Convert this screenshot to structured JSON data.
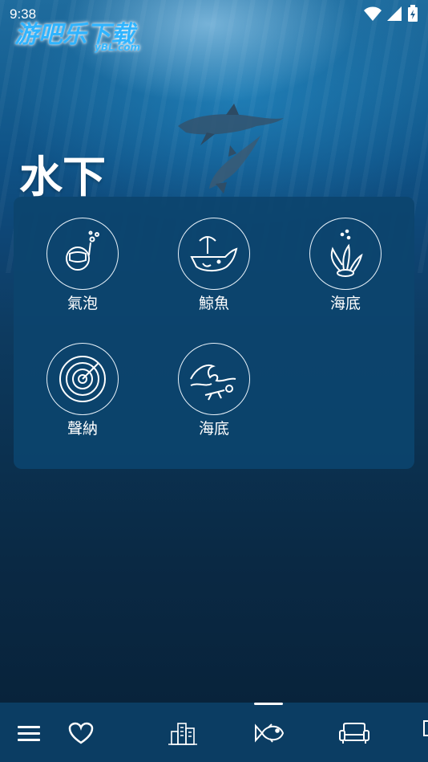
{
  "status_bar": {
    "time": "9:38",
    "icons": [
      "wifi-icon",
      "signal-icon",
      "battery-charging-icon"
    ]
  },
  "watermark": {
    "text": "游吧乐下载",
    "sub": "yBL.com"
  },
  "page": {
    "title": "水下"
  },
  "sounds": [
    {
      "label": "氣泡",
      "icon": "diver-bubbles-icon"
    },
    {
      "label": "鯨魚",
      "icon": "whale-icon"
    },
    {
      "label": "海底",
      "icon": "seaweed-icon"
    },
    {
      "label": "聲納",
      "icon": "sonar-icon"
    },
    {
      "label": "海底",
      "icon": "wave-swimmer-icon"
    }
  ],
  "bottom_nav": {
    "items": [
      "menu-icon",
      "heart-icon",
      "city-icon",
      "fish-icon",
      "sofa-icon"
    ],
    "active": "fish-icon"
  },
  "colors": {
    "panel": "#0c446e",
    "nav": "#0b3d63",
    "text": "#ffffff",
    "watermark": "#2fb4ff"
  }
}
